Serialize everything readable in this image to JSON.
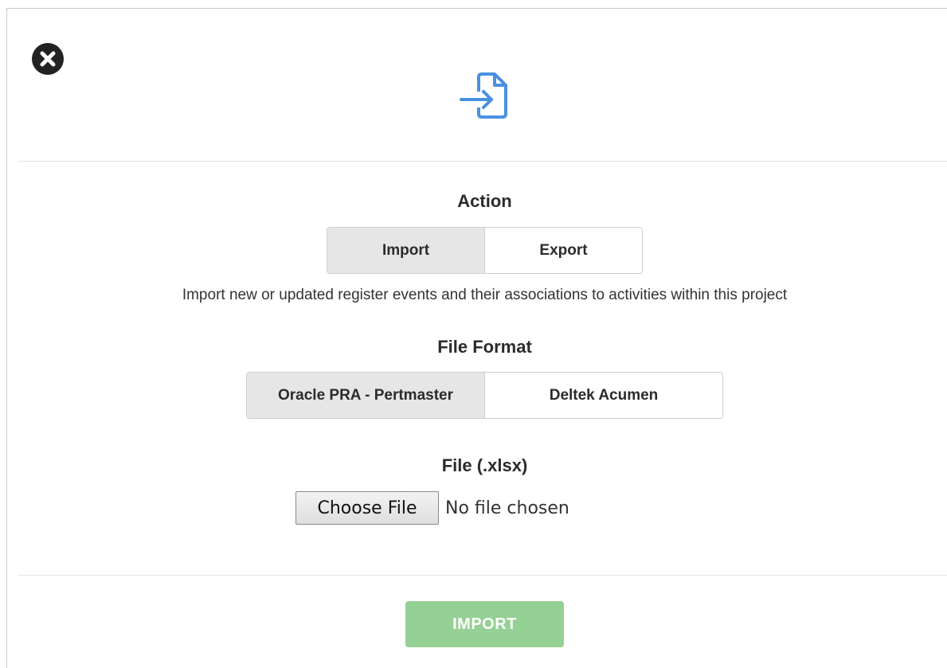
{
  "dialog": {
    "close_icon": "close-circle-icon",
    "header_icon": "file-import-icon",
    "accent_color": "#4a90e2"
  },
  "action": {
    "title": "Action",
    "options": [
      "Import",
      "Export"
    ],
    "selected": "Import",
    "description": "Import new or updated register events and their associations to activities within this project"
  },
  "file_format": {
    "title": "File Format",
    "options": [
      "Oracle PRA - Pertmaster",
      "Deltek Acumen"
    ],
    "selected": "Oracle PRA - Pertmaster"
  },
  "file": {
    "title": "File (.xlsx)",
    "choose_label": "Choose File",
    "status": "No file chosen"
  },
  "footer": {
    "submit_label": "IMPORT",
    "submit_color": "#95d095"
  }
}
